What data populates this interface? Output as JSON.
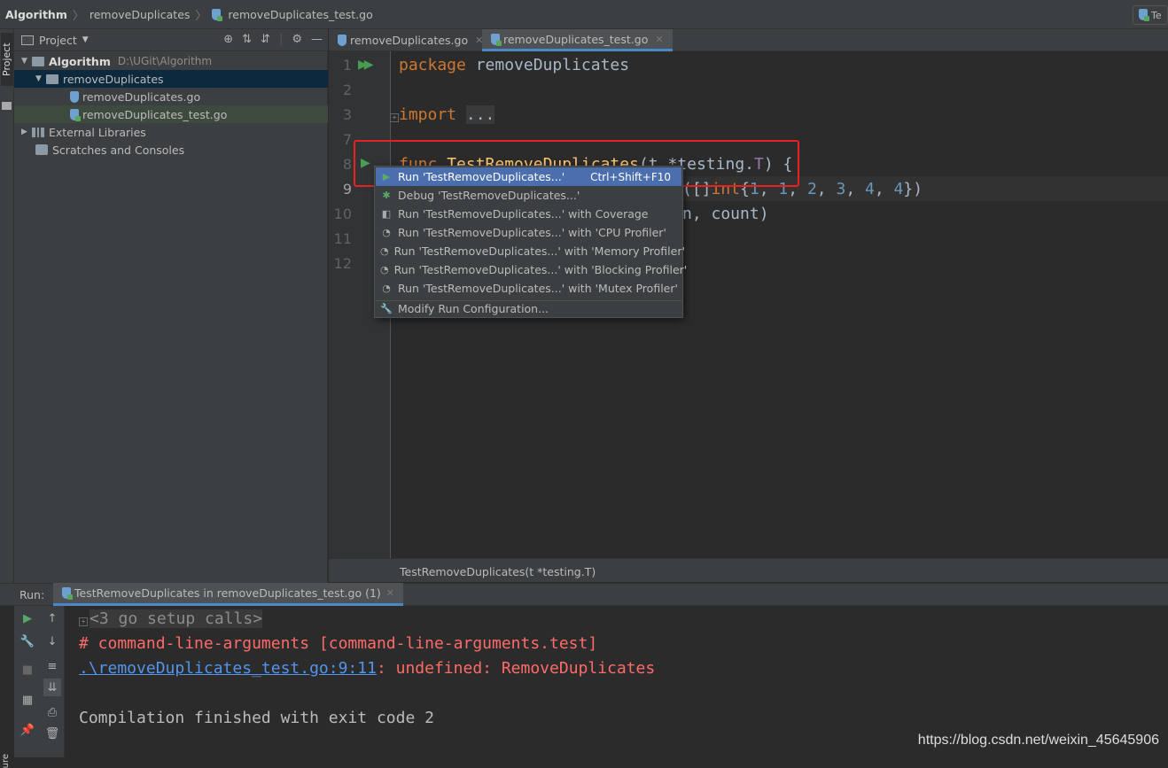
{
  "navbar": {
    "project": "Algorithm",
    "folder": "removeDuplicates",
    "file": "removeDuplicates_test.go",
    "right_label": "Te"
  },
  "sidebar": {
    "stripe_label": "Project",
    "header_label": "Project",
    "tree": [
      {
        "label": "Algorithm",
        "path": "D:\\UGit\\Algorithm"
      },
      {
        "label": "removeDuplicates"
      },
      {
        "label": "removeDuplicates.go"
      },
      {
        "label": "removeDuplicates_test.go"
      },
      {
        "label": "External Libraries"
      },
      {
        "label": "Scratches and Consoles"
      }
    ]
  },
  "tabs": [
    {
      "label": "removeDuplicates.go"
    },
    {
      "label": "removeDuplicates_test.go"
    }
  ],
  "editor": {
    "line_numbers": [
      "1",
      "2",
      "3",
      "7",
      "8",
      "9",
      "10",
      "11",
      "12"
    ],
    "line1": {
      "kw": "package",
      "name": "removeDuplicates"
    },
    "line3": {
      "kw": "import",
      "rest": "..."
    },
    "line8": {
      "kw": "func",
      "fn": "TestRemoveDuplicates",
      "rest1": "(t *testing.",
      "type": "T",
      "rest2": ") {"
    },
    "line9": {
      "prefix": "([]",
      "kw": "int",
      "brace": "{",
      "nums": [
        "1",
        "1",
        "2",
        "3",
        "4",
        "4"
      ],
      "suffix": "})"
    },
    "line10": {
      "text": "n, count)"
    }
  },
  "context_menu": [
    {
      "label": "Run 'TestRemoveDuplicates...'",
      "shortcut": "Ctrl+Shift+F10",
      "icon": "run-icon"
    },
    {
      "label": "Debug 'TestRemoveDuplicates...'",
      "icon": "debug-icon"
    },
    {
      "label": "Run 'TestRemoveDuplicates...' with Coverage",
      "icon": "coverage-icon"
    },
    {
      "label": "Run 'TestRemoveDuplicates...' with 'CPU Profiler'",
      "icon": "profiler-icon"
    },
    {
      "label": "Run 'TestRemoveDuplicates...' with 'Memory Profiler'",
      "icon": "profiler-icon"
    },
    {
      "label": "Run 'TestRemoveDuplicates...' with 'Blocking Profiler'",
      "icon": "profiler-icon"
    },
    {
      "label": "Run 'TestRemoveDuplicates...' with 'Mutex Profiler'",
      "icon": "profiler-icon"
    },
    {
      "label": "Modify Run Configuration...",
      "icon": "wrench-icon"
    }
  ],
  "breadcrumb": "TestRemoveDuplicates(t *testing.T)",
  "run_panel": {
    "label": "Run:",
    "tab": "TestRemoveDuplicates in removeDuplicates_test.go (1)",
    "console": {
      "setup": "<3 go setup calls>",
      "error1": "# command-line-arguments [command-line-arguments.test]",
      "error_link": ".\\removeDuplicates_test.go:9:11",
      "error_msg": ": undefined: RemoveDuplicates",
      "finish": "Compilation finished with exit code 2"
    }
  },
  "watermark": "https://blog.csdn.net/weixin_45645906",
  "bottom_stripe_label": "ure",
  "colors": {
    "accent": "#4a88c7",
    "selection": "#4b6eaf",
    "error": "#ff6b68",
    "highlight_box": "#e62222"
  }
}
